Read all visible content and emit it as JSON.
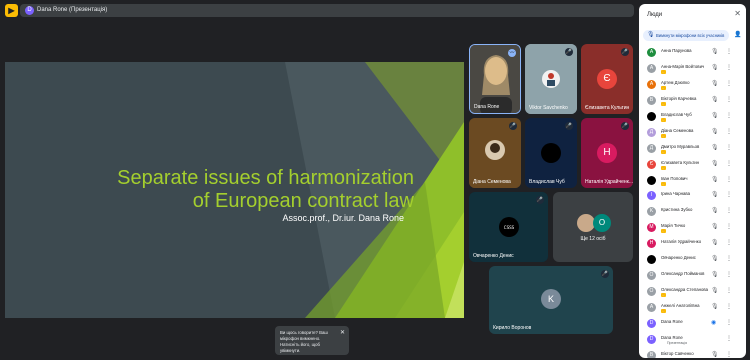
{
  "header": {
    "app_icon": "meet-logo-icon",
    "presenter_initial": "D",
    "title": "Dana Rone (Презентація)"
  },
  "slide": {
    "title_line1": "Separate issues of harmonization",
    "title_line2": "of European contract law",
    "subtitle": "Assoc.prof., Dr.iur. Dana Rone",
    "colors": {
      "background": "#3d4a50",
      "accent": "#a4cf2e",
      "accent_dark": "#5e8f1f"
    }
  },
  "tiles": [
    {
      "name": "Dana Rone",
      "type": "video",
      "speaking": true
    },
    {
      "name": "Viktor Savchenko",
      "type": "video"
    },
    {
      "name": "Єлизавета Культин",
      "type": "initial",
      "initial": "Є",
      "color": "#e8453c"
    },
    {
      "name": "Діана Семенова",
      "type": "video"
    },
    {
      "name": "Владислав Чуб",
      "type": "dark"
    },
    {
      "name": "Наталія Удрайченк...",
      "type": "initial",
      "initial": "Н",
      "color": "#d81b60"
    },
    {
      "name": "Овчаренко Денис",
      "type": "video"
    },
    {
      "name": "Ще 12 осіб",
      "type": "group",
      "initial": "O"
    },
    {
      "name": "Кирило Воронов",
      "type": "initial",
      "initial": "K",
      "color": "#7a8a99"
    }
  ],
  "toast": {
    "text": "Ви щось говорите? Ваш мікрофон вимкнено. Натисніть його, щоб увімкнути.",
    "close": "✕"
  },
  "panel": {
    "title": "Люди",
    "close": "✕",
    "mute_all": "Вимкнути мікрофони всіх учасників",
    "add_icon": "add-person-icon",
    "presenter_label": "Презентація",
    "participants": [
      {
        "name": "Анна Парунова",
        "initial": "А",
        "color": "#1e8e3e",
        "badge": false,
        "mic": "off"
      },
      {
        "name": "Анна-Марія Войтович",
        "initial": "A",
        "color": "#9aa0a6",
        "badge": true,
        "mic": "off"
      },
      {
        "name": "Артем Дзюпко",
        "initial": "A",
        "color": "#e8710a",
        "badge": true,
        "mic": "off"
      },
      {
        "name": "Вікторія Карчевка",
        "initial": "В",
        "color": "#9aa0a6",
        "badge": true,
        "mic": "off"
      },
      {
        "name": "Владислав Чуб",
        "initial": "",
        "color": "#000000",
        "badge": true,
        "mic": "off"
      },
      {
        "name": "Діана Семенова",
        "initial": "Д",
        "color": "#b39ddb",
        "badge": true,
        "mic": "off"
      },
      {
        "name": "Дмитро Муравльов",
        "initial": "Д",
        "color": "#9aa0a6",
        "badge": true,
        "mic": "off"
      },
      {
        "name": "Єлизавета Культин",
        "initial": "Є",
        "color": "#e8453c",
        "badge": true,
        "mic": "off"
      },
      {
        "name": "Іван Попович",
        "initial": "",
        "color": "#000000",
        "badge": true,
        "mic": "off"
      },
      {
        "name": "Ірина Чарнава",
        "initial": "I",
        "color": "#7b61ff",
        "badge": false,
        "mic": "off"
      },
      {
        "name": "Кристина Зубко",
        "initial": "K",
        "color": "#9aa0a6",
        "badge": false,
        "mic": "off"
      },
      {
        "name": "Марія Тичко",
        "initial": "M",
        "color": "#d81b60",
        "badge": true,
        "mic": "off"
      },
      {
        "name": "Наталія Удрайченко",
        "initial": "H",
        "color": "#d81b60",
        "badge": false,
        "mic": "off"
      },
      {
        "name": "Овчаренко Денис",
        "initial": "",
        "color": "#000000",
        "badge": false,
        "mic": "off"
      },
      {
        "name": "Олександр Пойманов",
        "initial": "O",
        "color": "#9aa0a6",
        "badge": false,
        "mic": "off"
      },
      {
        "name": "Олександра Степанова",
        "initial": "O",
        "color": "#9aa0a6",
        "badge": true,
        "mic": "off"
      },
      {
        "name": "Анжелі Анатоліївна",
        "initial": "A",
        "color": "#9aa0a6",
        "badge": true,
        "mic": "off"
      },
      {
        "name": "Dana Rone",
        "initial": "D",
        "color": "#7b61ff",
        "badge": false,
        "mic": "on"
      },
      {
        "name": "Dana Rone",
        "initial": "D",
        "color": "#7b61ff",
        "badge": false,
        "mic": "none",
        "sub": true
      },
      {
        "name": "Віктор Савченко",
        "initial": "В",
        "color": "#9aa0a6",
        "badge": false,
        "mic": "off"
      }
    ]
  }
}
